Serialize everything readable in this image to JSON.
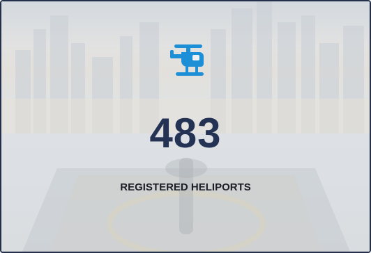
{
  "stat": {
    "value": "483",
    "label": "REGISTERED HELIPORTS",
    "icon": "helicopter-icon"
  },
  "colors": {
    "accent": "#1d8fd6",
    "number": "#243354",
    "border": "#24304a"
  }
}
